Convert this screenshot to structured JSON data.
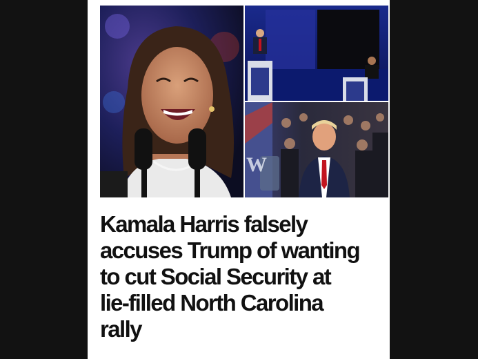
{
  "article": {
    "headline_lines": [
      "Kamala Harris falsely",
      "accuses Trump of wanting",
      "to cut Social Security at",
      "lie-filled North Carolina",
      "rally"
    ],
    "images": [
      {
        "description_icon": "harris-speaking-photo-icon"
      },
      {
        "description_icon": "debate-stage-photo-icon"
      },
      {
        "description_icon": "trump-crowd-photo-icon"
      }
    ]
  },
  "colors": {
    "page_background": "#121212",
    "card_background": "#ffffff",
    "headline_text": "#111111"
  }
}
